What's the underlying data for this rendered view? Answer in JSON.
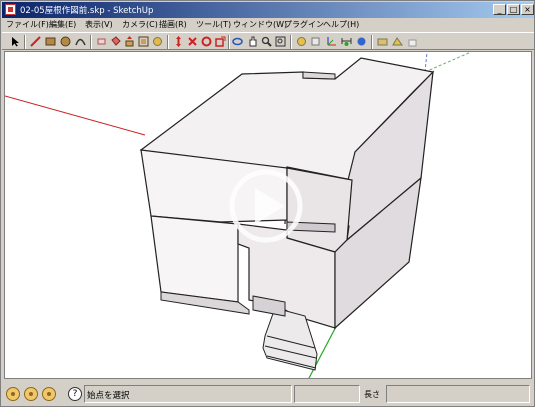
{
  "window": {
    "title": "02-05屋根作図前.skp - SketchUp",
    "min_label": "_",
    "max_label": "□",
    "close_label": "×"
  },
  "menu": [
    "ファイル(F)",
    "編集(E)",
    "表示(V)",
    "カメラ(C)",
    "描画(R)",
    "ツール(T)",
    "ウィンドウ(W)",
    "プラグイン",
    "ヘルプ(H)"
  ],
  "toolbar": {
    "icons": [
      "select-icon",
      "line-icon",
      "rectangle-icon",
      "circle-icon",
      "arc-icon",
      "eraser-icon",
      "paint-bucket-icon",
      "push-pull-icon",
      "offset-icon",
      "paint-icon",
      "move-icon",
      "rotate-icon",
      "follow-me-icon",
      "scale-icon",
      "orbit-icon",
      "pan-icon",
      "zoom-icon",
      "zoom-extents-icon",
      "tape-icon",
      "protractor-icon",
      "axes-icon",
      "dimension-icon",
      "text-icon",
      "section-icon",
      "component-icon"
    ]
  },
  "status": {
    "hint": "始点を選択",
    "vcb_label": "長さ",
    "help_label": "?"
  },
  "overlay": {
    "play_icon": "play-icon"
  },
  "colors": {
    "accent_title": "#0a246a",
    "axis_red": "#cc2222",
    "axis_green": "#22aa22",
    "axis_blue": "#2244cc",
    "model_face": "#f2eef0",
    "model_shadow": "#c8c4c6"
  }
}
